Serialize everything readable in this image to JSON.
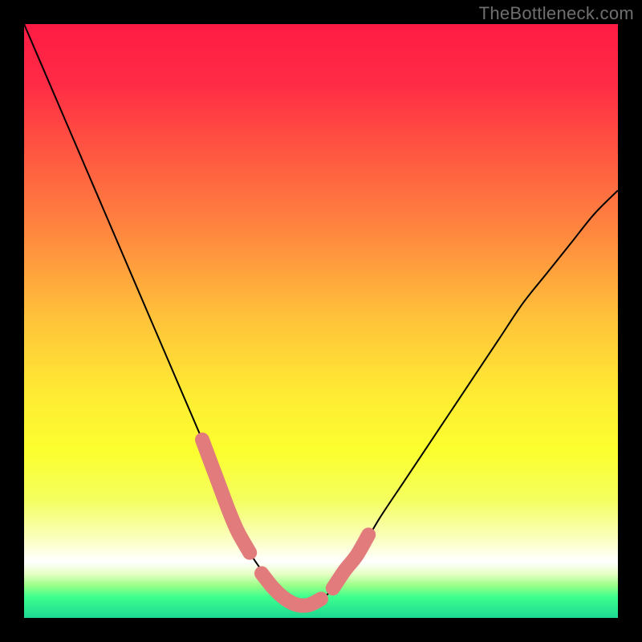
{
  "watermark": "TheBottleneck.com",
  "gradient": {
    "stops": [
      {
        "offset": 0.0,
        "color": "#ff1b44"
      },
      {
        "offset": 0.1,
        "color": "#ff2b45"
      },
      {
        "offset": 0.22,
        "color": "#ff5841"
      },
      {
        "offset": 0.35,
        "color": "#ff873f"
      },
      {
        "offset": 0.5,
        "color": "#ffc43a"
      },
      {
        "offset": 0.62,
        "color": "#ffea33"
      },
      {
        "offset": 0.72,
        "color": "#fbff2f"
      },
      {
        "offset": 0.8,
        "color": "#f4ff5e"
      },
      {
        "offset": 0.86,
        "color": "#faffb5"
      },
      {
        "offset": 0.905,
        "color": "#ffffff"
      },
      {
        "offset": 0.925,
        "color": "#e9ffc8"
      },
      {
        "offset": 0.945,
        "color": "#9bff88"
      },
      {
        "offset": 0.965,
        "color": "#3dff8e"
      },
      {
        "offset": 1.0,
        "color": "#1dd792"
      }
    ]
  },
  "chart_data": {
    "type": "line",
    "title": "",
    "xlabel": "",
    "ylabel": "",
    "xlim": [
      0,
      100
    ],
    "ylim": [
      0,
      100
    ],
    "curve": {
      "x": [
        0,
        3,
        6,
        9,
        12,
        15,
        18,
        21,
        24,
        27,
        30,
        32,
        34,
        36,
        38,
        40,
        42,
        44,
        46,
        48,
        50,
        52,
        54,
        57,
        60,
        64,
        68,
        72,
        76,
        80,
        84,
        88,
        92,
        96,
        100
      ],
      "y": [
        100,
        93,
        86,
        79,
        72,
        65,
        58,
        51,
        44,
        37,
        30,
        25,
        20,
        15,
        11,
        8,
        5,
        3,
        2,
        2,
        3,
        5,
        8,
        12,
        17,
        23,
        29,
        35,
        41,
        47,
        53,
        58,
        63,
        68,
        72
      ]
    },
    "highlight_segments": [
      {
        "x": [
          30.0,
          31.5,
          33.0,
          34.5,
          36.0,
          38.0
        ],
        "y": [
          30.0,
          26.0,
          22.0,
          18.0,
          14.5,
          11.0
        ]
      },
      {
        "x": [
          40.0,
          42.0,
          44.0,
          46.0,
          48.0,
          50.0
        ],
        "y": [
          7.5,
          5.0,
          3.2,
          2.2,
          2.2,
          3.2
        ]
      },
      {
        "x": [
          52.0,
          54.0,
          56.0,
          58.0
        ],
        "y": [
          5.0,
          8.0,
          10.5,
          14.0
        ]
      }
    ],
    "colors": {
      "curve": "#000000",
      "highlight": "#e27b7b"
    }
  }
}
